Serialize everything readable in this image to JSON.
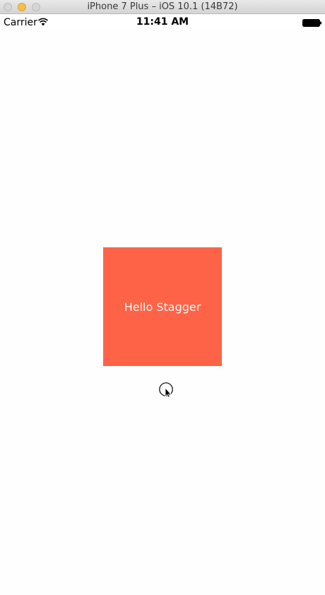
{
  "window": {
    "title": "iPhone 7 Plus – iOS 10.1 (14B72)"
  },
  "status_bar": {
    "carrier": "Carrier",
    "time": "11:41 AM",
    "icons": [
      "wifi-icon",
      "battery-icon"
    ]
  },
  "main": {
    "box_label": "Hello Stagger",
    "box_color": "#ff6347"
  },
  "cursor": {
    "icon": "pointer-cursor-icon"
  }
}
